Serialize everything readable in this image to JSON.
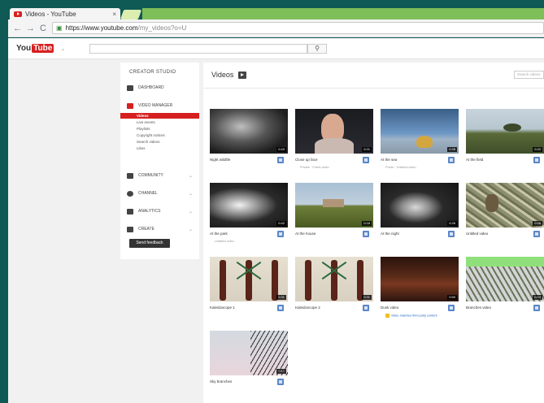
{
  "browser": {
    "tab_title": "Videos - YouTube",
    "tab_close": "×",
    "url_host": "https://www.youtube.com",
    "url_path": "/my_videos?o=U",
    "back": "←",
    "forward": "→",
    "reload": "C"
  },
  "header": {
    "logo_you": "You",
    "logo_tube": "Tube",
    "search_button": "⚲"
  },
  "sidebar": {
    "studio_title": "CREATOR STUDIO",
    "dashboard": "DASHBOARD",
    "video_manager": "VIDEO MANAGER",
    "sub_items": [
      "Videos",
      "Live events",
      "Playlists",
      "Copyright notices",
      "Search videos",
      "Likes"
    ],
    "community": "COMMUNITY",
    "channel": "CHANNEL",
    "analytics": "ANALYTICS",
    "create": "CREATE",
    "feedback": "Send feedback",
    "chevron": "⌄"
  },
  "main": {
    "title": "Videos",
    "search_placeholder": "Search videos"
  },
  "videos": [
    {
      "title": "Night wildlife",
      "meta": "",
      "duration": "0:43"
    },
    {
      "title": "Close up face",
      "meta": "Private · Public video",
      "duration": "0:21"
    },
    {
      "title": "At the sea",
      "meta": "Public · Unlisted video",
      "duration": "0:35"
    },
    {
      "title": "At the field",
      "meta": "",
      "duration": "0:20"
    },
    {
      "title": "At the park",
      "meta": "Unlisted video",
      "duration": "0:42"
    },
    {
      "title": "At the house",
      "meta": "",
      "duration": "0:18"
    },
    {
      "title": "At the night",
      "meta": "",
      "duration": "0:26"
    },
    {
      "title": "Untitled video",
      "meta": "",
      "duration": "0:28"
    },
    {
      "title": "Kaleidoscope 1",
      "meta": "",
      "duration": "0:31"
    },
    {
      "title": "Kaleidoscope 2",
      "meta": "",
      "duration": "0:31"
    },
    {
      "title": "Dusk video",
      "meta": "Video matches third party content",
      "duration": "0:50"
    },
    {
      "title": "Branches video",
      "meta": "",
      "duration": "0:24"
    },
    {
      "title": "Sky branches",
      "meta": "",
      "duration": "0:19"
    }
  ]
}
